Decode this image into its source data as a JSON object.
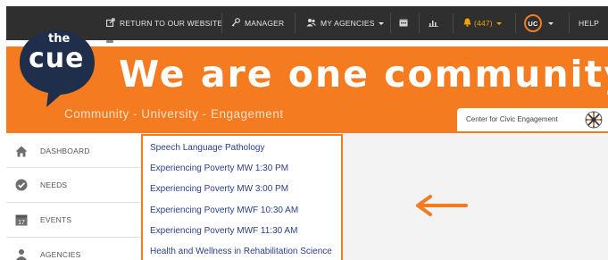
{
  "colors": {
    "accent": "#f47b20",
    "navbar": "#2f2f2f",
    "link": "#2c3e8c",
    "notification": "#f2a400"
  },
  "topnav": {
    "return_label": "RETURN TO OUR WEBSITE",
    "return_icon": "external-link-icon",
    "manager_label": "MANAGER",
    "manager_icon": "key-icon",
    "agencies_label": "MY AGENCIES",
    "agencies_icon": "users-icon",
    "calendar_icon": "calendar-icon",
    "stats_icon": "bar-chart-icon",
    "notifications_label": "(447)",
    "notifications_icon": "bell-icon",
    "user_initials": "UC",
    "help_label": "HELP"
  },
  "banner": {
    "logo_top": "the",
    "logo_bottom": "cue",
    "headline": "We are one community.",
    "tagline": "Community - University - Engagement",
    "center_label": "Center for Civic Engagement"
  },
  "sidebar": {
    "items": [
      {
        "label": "DASHBOARD",
        "icon": "home-icon"
      },
      {
        "label": "NEEDS",
        "icon": "check-circle-icon"
      },
      {
        "label": "EVENTS",
        "icon": "calendar-icon",
        "icon_text": "17"
      },
      {
        "label": "AGENCIES",
        "icon": "agency-icon"
      }
    ]
  },
  "dropdown": {
    "items": [
      "Speech Language Pathology",
      "Experiencing Poverty MW 1:30 PM",
      "Experiencing Poverty MW 3:00 PM",
      "Experiencing Poverty MWF 10:30 AM",
      "Experiencing Poverty MWF 11:30 AM",
      "Health and Wellness in Rehabilitation Science"
    ]
  }
}
